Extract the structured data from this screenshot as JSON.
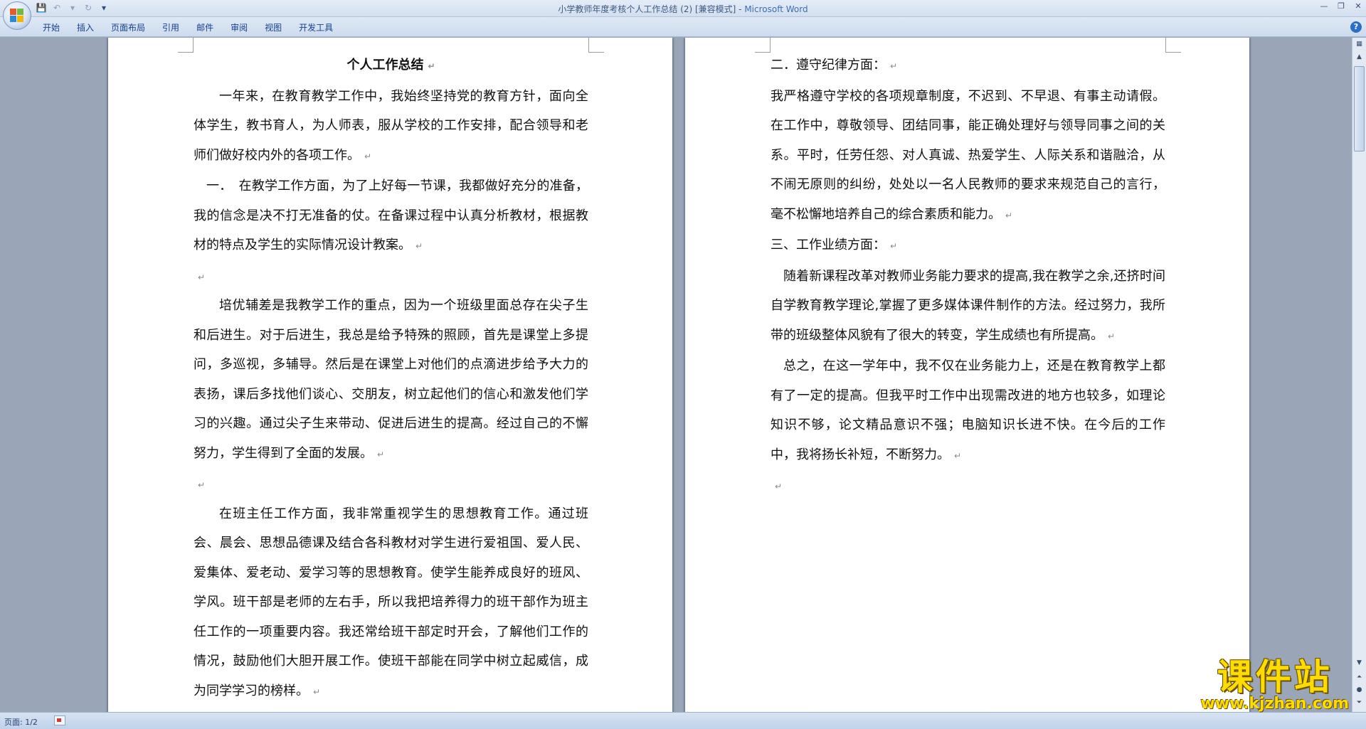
{
  "window": {
    "title": "小学教师年度考核个人工作总结 (2) [兼容模式] - ",
    "app_name": "Microsoft Word"
  },
  "ribbon": {
    "tabs": [
      "开始",
      "插入",
      "页面布局",
      "引用",
      "邮件",
      "审阅",
      "视图",
      "开发工具"
    ]
  },
  "document": {
    "left_page": {
      "title": "个人工作总结",
      "intro": "一年来，在教育教学工作中，我始终坚持党的教育方针，面向全体学生，教书育人，为人师表，服从学校的工作安排，配合领导和老师们做好校内外的各项工作。",
      "section1": "一．　在教学工作方面，为了上好每一节课，我都做好充分的准备，我的信念是决不打无准备的仗。在备课过程中认真分析教材，根据教材的特点及学生的实际情况设计教案。",
      "para2": "培优辅差是我教学工作的重点，因为一个班级里面总存在尖子生和后进生。对于后进生，我总是给予特殊的照顾，首先是课堂上多提问，多巡视，多辅导。然后是在课堂上对他们的点滴进步给予大力的表扬，课后多找他们谈心、交朋友，树立起他们的信心和激发他们学习的兴趣。通过尖子生来带动、促进后进生的提高。经过自己的不懈努力，学生得到了全面的发展。",
      "para3": "在班主任工作方面，我非常重视学生的思想教育工作。通过班会、晨会、思想品德课及结合各科教材对学生进行爱祖国、爱人民、爱集体、爱老动、爱学习等的思想教育。使学生能养成良好的班风、学风。班干部是老师的左右手，所以我把培养得力的班干部作为班主任工作的一项重要内容。我还常给班干部定时开会，了解他们工作的情况，鼓励他们大胆开展工作。使班干部能在同学中树立起威信，成为同学学习的榜样。"
    },
    "right_page": {
      "heading2": "二．遵守纪律方面：",
      "para_discipline": "我严格遵守学校的各项规章制度，不迟到、不早退、有事主动请假。在工作中，尊敬领导、团结同事，能正确处理好与领导同事之间的关系。平时，任劳任怨、对人真诚、热爱学生、人际关系和谐融洽，从不闹无原则的纠纷，处处以一名人民教师的要求来规范自己的言行，毫不松懈地培养自己的综合素质和能力。",
      "heading3": "三、工作业绩方面：",
      "para_achievement": "随着新课程改革对教师业务能力要求的提高,我在教学之余,还挤时间自学教育教学理论,掌握了更多媒体课件制作的方法。经过努力，我所带的班级整体风貌有了很大的转变，学生成绩也有所提高。",
      "para_summary": "总之，在这一学年中，我不仅在业务能力上，还是在教育教学上都有了一定的提高。但我平时工作中出现需改进的地方也较多，如理论知识不够，论文精品意识不强；电脑知识长进不快。在今后的工作中，我将扬长补短，不断努力。"
    },
    "paragraph_mark": "↵"
  },
  "statusbar": {
    "page_info": "页面: 1/2"
  },
  "watermark": {
    "brand": "课件站",
    "url": "www.kjzhan.com"
  },
  "icons": {
    "save": "save-icon",
    "undo": "undo-icon",
    "redo": "redo-icon"
  },
  "colors": {
    "title_app": "#3c6fb5",
    "tab_text": "#15428b",
    "watermark": "#ffdc00"
  }
}
